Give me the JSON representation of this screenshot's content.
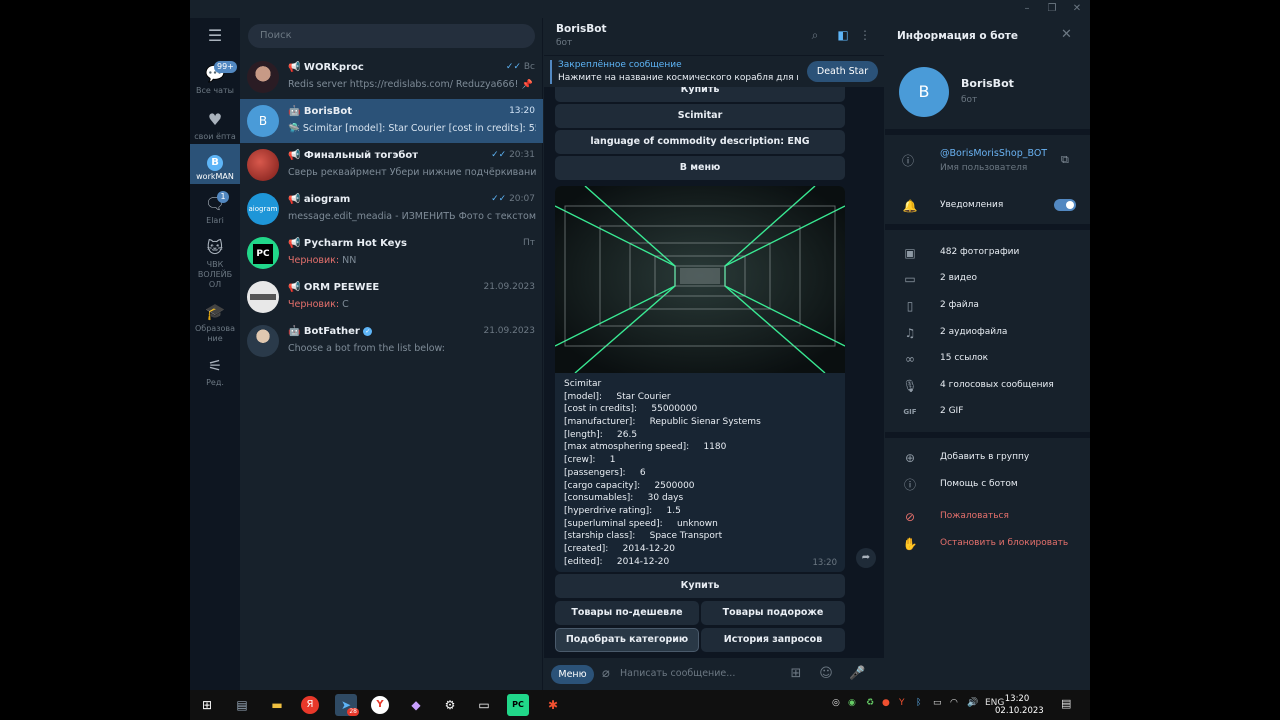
{
  "window": {
    "minimize": "–",
    "maximize": "❐",
    "close": "✕"
  },
  "rail": [
    {
      "label": "Все чаты",
      "badge": "99+",
      "icon": "chat-bubbles-icon"
    },
    {
      "label": "свои ёпта",
      "badge": "",
      "icon": "heart-icon"
    },
    {
      "label": "workMAN",
      "badge": "",
      "icon": "bitcoin-icon"
    },
    {
      "label": "Elari",
      "badge": "1",
      "icon": "chat-icon"
    },
    {
      "label": "ЧВК ВОЛЕЙБОЛ",
      "badge": "",
      "icon": "cat-icon"
    },
    {
      "label": "Образование",
      "badge": "",
      "icon": "graduation-cap-icon"
    },
    {
      "label": "Ред.",
      "badge": "",
      "icon": "sliders-icon"
    }
  ],
  "search": {
    "placeholder": "Поиск"
  },
  "chats": [
    {
      "name": "📢 WORKproc",
      "time": "Вс",
      "preview": "Redis server https://redislabs.com/ Reduzya666!",
      "draft": "",
      "avatar": "",
      "avatar_color": "#5a3b4a"
    },
    {
      "name": "🤖 BorisBot",
      "time": "13:20",
      "preview": "🛸 Scimitar [model]:     Star Courier [cost in credits]:     550...",
      "draft": "",
      "avatar": "B",
      "avatar_color": "#4a9bd8"
    },
    {
      "name": "📢 Финальный тогэбот",
      "time": "20:31",
      "preview": "Сверь реквайрмент  Убери нижние подчёркивания в ...",
      "draft": "",
      "avatar": "",
      "avatar_color": "#b4302a"
    },
    {
      "name": "📢 aiogram",
      "time": "20:07",
      "preview": "message.edit_meadia - ИЗМЕНИТЬ Фото с текстом,(собр...",
      "draft": "",
      "avatar": "",
      "avatar_color": "#1e96d8"
    },
    {
      "name": "📢 Pycharm Hot Keys",
      "time": "Пт",
      "preview": "NN",
      "draft": "Черновик: ",
      "avatar": "PC",
      "avatar_color": "#21d789"
    },
    {
      "name": "📢 ORM PEEWEE",
      "time": "21.09.2023",
      "preview": "C",
      "draft": "Черновик: ",
      "avatar": "",
      "avatar_color": "#e8e8e8"
    },
    {
      "name": "🤖 BotFather",
      "time": "21.09.2023",
      "preview": "Choose a bot from the list below:",
      "draft": "",
      "avatar": "",
      "avatar_color": "#3a6d99"
    }
  ],
  "chat": {
    "title": "BorisBot",
    "subtitle": "бот",
    "pinned_title": "Закреплённое сообщение",
    "pinned_text": "Нажмите на название космического корабля для вы...",
    "pinned_button": "Death Star",
    "top_buttons": [
      "Купить",
      "Scimitar",
      "language of commodity description: ENG",
      "В меню"
    ],
    "message_lines": [
      "Scimitar",
      "[model]:     Star Courier",
      "[cost in credits]:     55000000",
      "[manufacturer]:     Republic Sienar Systems",
      "[length]:     26.5",
      "[max atmosphering speed]:     1180",
      "[crew]:     1",
      "[passengers]:     6",
      "[cargo capacity]:     2500000",
      "[consumables]:     30 days",
      "[hyperdrive rating]:     1.5",
      "[superluminal speed]:     unknown",
      "[starship class]:     Space Transport",
      "[created]:     2014-12-20",
      "[edited]:     2014-12-20"
    ],
    "message_time": "13:20",
    "kb_buy": "Купить",
    "kb_cheaper": "Товары по-дешевле",
    "kb_pricier": "Товары подороже",
    "kb_category": "Подобрать категорию",
    "kb_history": "История запросов",
    "menu_button": "Меню",
    "input_placeholder": "Написать сообщение..."
  },
  "side": {
    "title": "Информация о боте",
    "name": "BorisBot",
    "avatar": "B",
    "subtitle": "бот",
    "username": "@BorisMorisShop_BOT",
    "username_label": "Имя пользователя",
    "notifications": "Уведомления",
    "notifications_on": true,
    "media": [
      {
        "label": "482 фотографии",
        "icon": "photo-icon"
      },
      {
        "label": "2 видео",
        "icon": "video-icon"
      },
      {
        "label": "2 файла",
        "icon": "file-icon"
      },
      {
        "label": "2 аудиофайла",
        "icon": "headphones-icon"
      },
      {
        "label": "15 ссылок",
        "icon": "link-icon"
      },
      {
        "label": "4 голосовых сообщения",
        "icon": "microphone-icon"
      },
      {
        "label": "2 GIF",
        "icon": "gif-icon"
      }
    ],
    "add_to_group": "Добавить в группу",
    "help": "Помощь с ботом",
    "report": "Пожаловаться",
    "block": "Остановить и блокировать"
  },
  "taskbar": {
    "lang": "ENG",
    "time": "13:20",
    "date": "02.10.2023",
    "telegram_badge": "28"
  }
}
